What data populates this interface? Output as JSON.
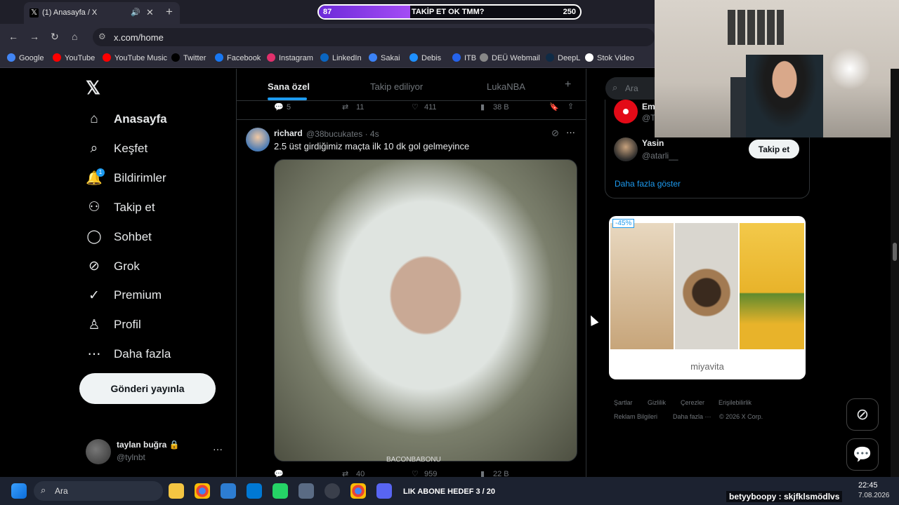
{
  "browser": {
    "tab_title": "(1) Anasayfa / X",
    "tab_favicon": "𝕏",
    "url": "x.com/home",
    "progress": {
      "left_value": "87",
      "label": "TAKİP ET OK TMM?",
      "right_value": "250",
      "fill_percent": 35
    },
    "bookmarks": [
      {
        "label": "Google",
        "color": "#4285f4"
      },
      {
        "label": "YouTube",
        "color": "#ff0000"
      },
      {
        "label": "YouTube Music",
        "color": "#ff0000"
      },
      {
        "label": "Twitter",
        "color": "#000000"
      },
      {
        "label": "Facebook",
        "color": "#1877f2"
      },
      {
        "label": "Instagram",
        "color": "#e1306c"
      },
      {
        "label": "LinkedIn",
        "color": "#0a66c2"
      },
      {
        "label": "Sakai",
        "color": "#3b82f6"
      },
      {
        "label": "Debis",
        "color": "#1e90ff"
      },
      {
        "label": "ITB",
        "color": "#2563eb"
      },
      {
        "label": "DEÜ Webmail",
        "color": "#888888"
      },
      {
        "label": "DeepL",
        "color": "#0f2b46"
      },
      {
        "label": "Stok Video",
        "color": "#ffffff"
      }
    ]
  },
  "sidebar": {
    "items": [
      {
        "label": "Anasayfa",
        "icon": "home-icon"
      },
      {
        "label": "Keşfet",
        "icon": "search-icon"
      },
      {
        "label": "Bildirimler",
        "icon": "bell-icon"
      },
      {
        "label": "Takip et",
        "icon": "person-add-icon"
      },
      {
        "label": "Sohbet",
        "icon": "chat-icon"
      },
      {
        "label": "Grok",
        "icon": "grok-icon"
      },
      {
        "label": "Premium",
        "icon": "verified-icon"
      },
      {
        "label": "Profil",
        "icon": "person-icon"
      },
      {
        "label": "Daha fazla",
        "icon": "more-circle-icon"
      }
    ],
    "notification_count": "1",
    "post_button": "Gönderi yayınla",
    "account": {
      "name": "taylan buğra 🔒",
      "handle": "@tylnbt"
    }
  },
  "feed": {
    "tabs": [
      "Sana özel",
      "Takip ediliyor",
      "LukaNBA"
    ],
    "prev_tweet_actions": {
      "replies": "5",
      "reposts": "11",
      "likes": "411",
      "views": "38 B"
    },
    "tweet": {
      "name": "richard",
      "handle": "@38bucukates · 4s",
      "text": "2.5 üst girdiğimiz maçta ilk 10 dk gol gelmeyince",
      "media_caption": "BACONBABONU",
      "actions": {
        "reposts": "40",
        "likes": "959",
        "views": "22 B"
      }
    }
  },
  "right": {
    "search_placeholder": "Ara",
    "suggestions": [
      {
        "name": "Em",
        "handle": "@T"
      },
      {
        "name": "Yasin",
        "handle": "@atarli__"
      }
    ],
    "follow_button": "Takip et",
    "show_more": "Daha fazla göster",
    "ad": {
      "discount": "-45%",
      "brand": "miyavita"
    },
    "footer_row1": [
      "Şartlar",
      "Gizlilik",
      "Çerezler",
      "Erişilebilirlik"
    ],
    "footer_row2": [
      "Reklam Bilgileri",
      "Daha fazla ···",
      "© 2026 X Corp."
    ]
  },
  "taskbar": {
    "search_placeholder": "Ara",
    "goal_text": "LIK ABONE HEDEF 3 / 20",
    "chat_overlay": "betyyboopy : skjfklsmödlvs",
    "time": "22:45",
    "date": "7.08.2026"
  }
}
